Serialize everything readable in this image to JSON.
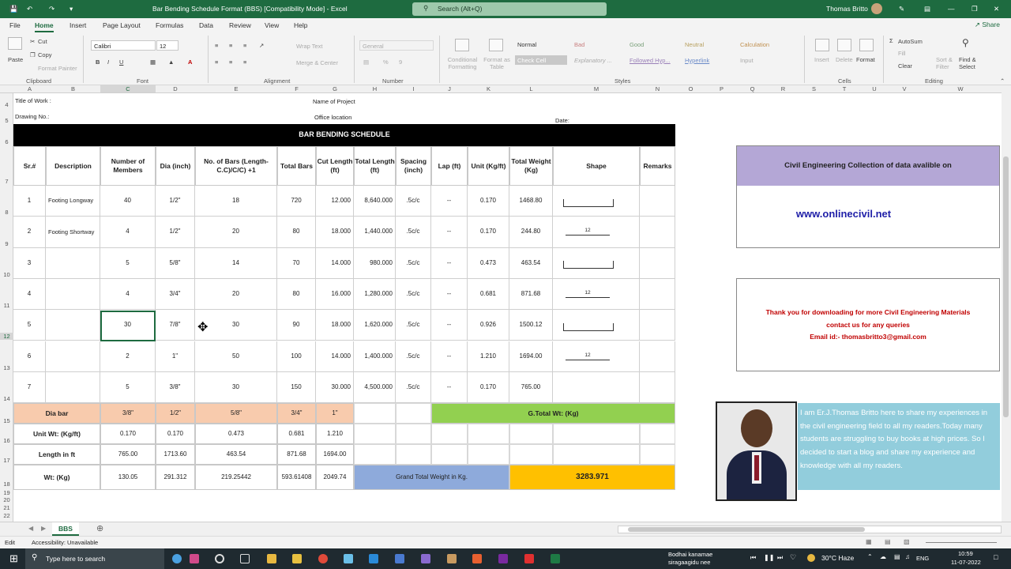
{
  "titlebar": {
    "title": "Bar Bending Schedule Format (BBS)  [Compatibility Mode]  -  Excel",
    "search": "Search (Alt+Q)",
    "user": "Thomas Britto"
  },
  "menu": [
    "File",
    "Home",
    "Insert",
    "Page Layout",
    "Formulas",
    "Data",
    "Review",
    "View",
    "Help"
  ],
  "share": "Share",
  "ribbon": {
    "paste": "Paste",
    "cut": "Cut",
    "copy": "Copy",
    "format_painter": "Format Painter",
    "clipboard": "Clipboard",
    "font_name": "Calibri",
    "font_size": "12",
    "font_group": "Font",
    "wrap_text": "Wrap Text",
    "merge_center": "Merge & Center",
    "alignment": "Alignment",
    "number_format": "General",
    "number": "Number",
    "conditional": "Conditional Formatting",
    "format_as_table": "Format as Table",
    "styles": [
      "Normal",
      "Bad",
      "Good",
      "Neutral",
      "Calculation",
      "Check Cell",
      "Explanatory ...",
      "Followed Hyp...",
      "Hyperlink",
      "Input"
    ],
    "styles_group": "Styles",
    "insert": "Insert",
    "delete": "Delete",
    "format": "Format",
    "cells": "Cells",
    "autosum": "AutoSum",
    "fill": "Fill",
    "clear": "Clear",
    "sort_filter": "Sort & Filter",
    "find_select": "Find & Select",
    "editing": "Editing"
  },
  "columns": [
    "A",
    "B",
    "C",
    "D",
    "E",
    "F",
    "G",
    "H",
    "I",
    "J",
    "K",
    "L",
    "M",
    "N",
    "O",
    "P",
    "Q",
    "R",
    "S",
    "T",
    "U",
    "V",
    "W"
  ],
  "rows": [
    "4",
    "5",
    "6",
    "7",
    "8",
    "9",
    "10",
    "11",
    "12",
    "13",
    "14",
    "15",
    "16",
    "17",
    "18",
    "19",
    "20",
    "21",
    "22"
  ],
  "sheet": {
    "title_of_work": "Title of Work :",
    "name_of_project": "Name of Project",
    "drawing_no": "Drawing No.:",
    "office_location": "Office location",
    "date": "Date:",
    "heading": "BAR BENDING SCHEDULE",
    "headers": [
      "Sr.#",
      "Description",
      "Number of Members",
      "Dia (inch)",
      "No. of Bars (Length-C.C)/C/C)   +1",
      "Total Bars",
      "Cut Length (ft)",
      "Total Length (ft)",
      "Spacing (inch)",
      "Lap (ft)",
      "Unit (Kg/ft)",
      "Total Weight (Kg)",
      "Shape",
      "Remarks"
    ],
    "rows": [
      [
        "1",
        "Footing Longway",
        "40",
        "1/2\"",
        "18",
        "720",
        "12.000",
        "8,640.000",
        ".5c/c",
        "--",
        "0.170",
        "1468.80"
      ],
      [
        "2",
        "Footing Shortway",
        "4",
        "1/2\"",
        "20",
        "80",
        "18.000",
        "1,440.000",
        ".5c/c",
        "--",
        "0.170",
        "244.80"
      ],
      [
        "3",
        "",
        "5",
        "5/8\"",
        "14",
        "70",
        "14.000",
        "980.000",
        ".5c/c",
        "--",
        "0.473",
        "463.54"
      ],
      [
        "4",
        "",
        "4",
        "3/4\"",
        "20",
        "80",
        "16.000",
        "1,280.000",
        ".5c/c",
        "--",
        "0.681",
        "871.68"
      ],
      [
        "5",
        "",
        "30",
        "7/8\"",
        "30",
        "90",
        "18.000",
        "1,620.000",
        ".5c/c",
        "--",
        "0.926",
        "1500.12"
      ],
      [
        "6",
        "",
        "2",
        "1\"",
        "50",
        "100",
        "14.000",
        "1,400.000",
        ".5c/c",
        "--",
        "1.210",
        "1694.00"
      ],
      [
        "7",
        "",
        "5",
        "3/8\"",
        "30",
        "150",
        "30.000",
        "4,500.000",
        ".5c/c",
        "--",
        "0.170",
        "765.00"
      ]
    ],
    "shape_label": "12",
    "summary": {
      "dia_bar_label": "Dia bar",
      "dia_values": [
        "3/8\"",
        "1/2\"",
        "5/8\"",
        "3/4\"",
        "1\""
      ],
      "unit_wt_label": "Unit Wt: (Kg/ft)",
      "unit_wt_values": [
        "0.170",
        "0.170",
        "0.473",
        "0.681",
        "1.210"
      ],
      "length_label": "Length in ft",
      "length_values": [
        "765.00",
        "1713.60",
        "463.54",
        "871.68",
        "1694.00"
      ],
      "wt_label": "Wt: (Kg)",
      "wt_values": [
        "130.05",
        "291.312",
        "219.25442",
        "593.61408",
        "2049.74"
      ],
      "gtotal_label": "G.Total Wt: (Kg)",
      "grand_total_label": "Grand Total Weight in Kg.",
      "grand_total_value": "3283.971"
    }
  },
  "side": {
    "banner": "Civil Engineering Collection of data avalible on",
    "website": "www.onlinecivil.net",
    "thanks1": "Thank you for downloading for more Civil Engineering Materials",
    "thanks2": "contact us for any queries",
    "email": "Email id:- thomasbritto3@gmail.com",
    "about": "I am Er.J.Thomas Britto here to share my experiences in the civil engineering field to all my readers.Today many students are struggling to buy books at high prices. So I decided to start a blog and share my experience and knowledge with all my readers."
  },
  "sheet_tab": "BBS",
  "status": {
    "mode": "Edit",
    "accessibility": "Accessibility: Unavailable"
  },
  "taskbar": {
    "search": "Type here to search",
    "news1": "Bodhai kanamae",
    "news2": "siragaagidu nee",
    "weather": "30°C  Haze",
    "lang": "ENG",
    "time": "10:59",
    "date": "11-07-2022"
  },
  "colors": {
    "excel_green": "#1e6b40",
    "header_peach": "#f8cbad",
    "gtotal_green": "#92d050",
    "grand_blue": "#8eaadb",
    "grand_orange": "#ffc000",
    "banner_purple": "#b4a7d6",
    "about_teal": "#92cddc",
    "link_blue": "#1f1fa8",
    "red_text": "#c00000"
  }
}
